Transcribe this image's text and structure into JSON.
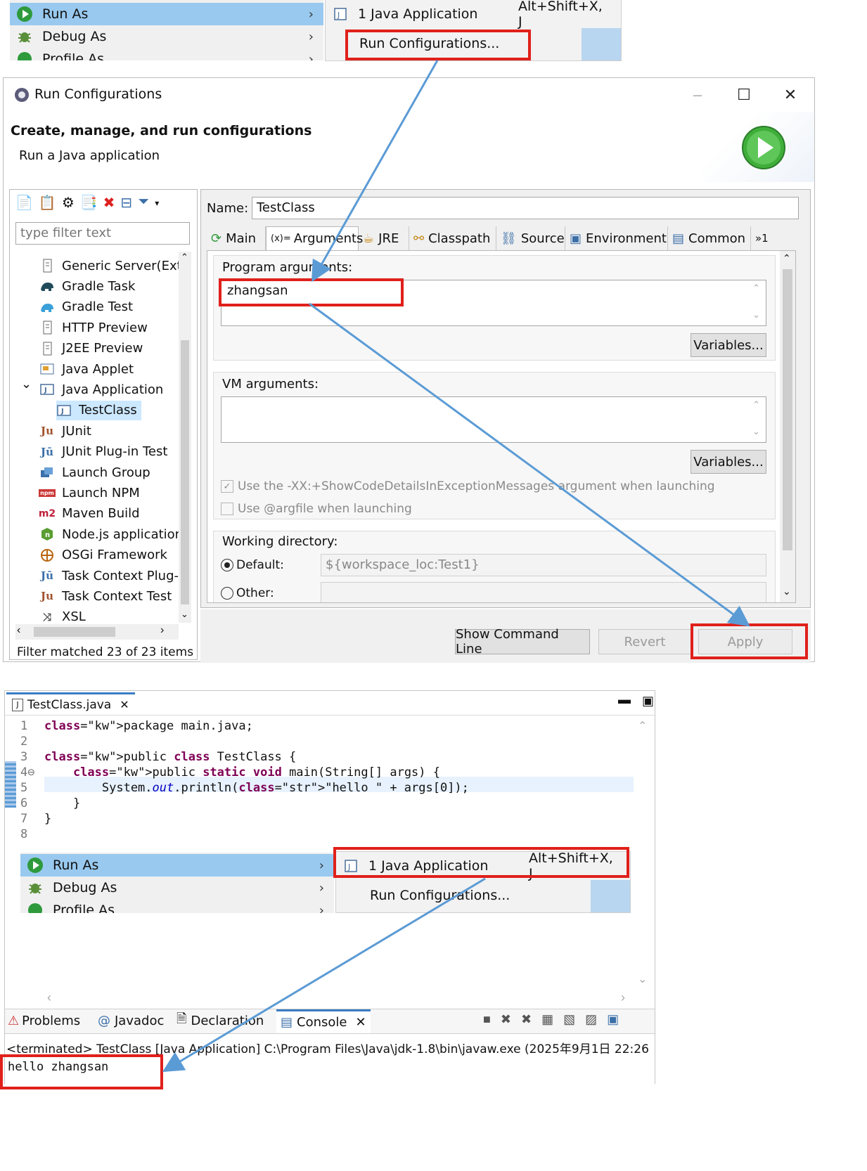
{
  "top_menu": {
    "items": [
      {
        "label": "Run As",
        "selected": true
      },
      {
        "label": "Debug As",
        "selected": false
      },
      {
        "label": "Profile As",
        "selected": false
      }
    ],
    "submenu": {
      "item1": {
        "label": "1 Java Application",
        "shortcut": "Alt+Shift+X, J"
      },
      "item2": {
        "label": "Run Configurations..."
      }
    }
  },
  "dialog": {
    "title": "Run Configurations",
    "header_title": "Create, manage, and run configurations",
    "header_subtitle": "Run a Java application",
    "window_controls": {
      "minimize": "–",
      "maximize": "☐",
      "close": "✕"
    },
    "filter_placeholder": "type filter text",
    "tree_items": [
      {
        "label": "Generic Server(Exte",
        "icon": "doc",
        "indent": 0
      },
      {
        "label": "Gradle Task",
        "icon": "elephant",
        "indent": 0
      },
      {
        "label": "Gradle Test",
        "icon": "elephant-blue",
        "indent": 0
      },
      {
        "label": "HTTP Preview",
        "icon": "doc",
        "indent": 0
      },
      {
        "label": "J2EE Preview",
        "icon": "doc",
        "indent": 0
      },
      {
        "label": "Java Applet",
        "icon": "applet",
        "indent": 0
      },
      {
        "label": "Java Application",
        "icon": "java-app",
        "indent": 0,
        "expanded": true
      },
      {
        "label": "TestClass",
        "icon": "java-app",
        "indent": 1,
        "selected": true
      },
      {
        "label": "JUnit",
        "icon": "junit",
        "indent": 0
      },
      {
        "label": "JUnit Plug-in Test",
        "icon": "junit-plugin",
        "indent": 0
      },
      {
        "label": "Launch Group",
        "icon": "launch-group",
        "indent": 0
      },
      {
        "label": "Launch NPM",
        "icon": "npm",
        "indent": 0
      },
      {
        "label": "Maven Build",
        "icon": "m2",
        "indent": 0
      },
      {
        "label": "Node.js application",
        "icon": "nodejs",
        "indent": 0
      },
      {
        "label": "OSGi Framework",
        "icon": "osgi",
        "indent": 0
      },
      {
        "label": "Task Context Plug-i",
        "icon": "junit-plugin",
        "indent": 0
      },
      {
        "label": "Task Context Test",
        "icon": "junit",
        "indent": 0
      },
      {
        "label": "XSL",
        "icon": "xsl",
        "indent": 0
      }
    ],
    "filter_status": "Filter matched 23 of 23 items",
    "name_label": "Name:",
    "name_value": "TestClass",
    "tabs": [
      {
        "label": "Main"
      },
      {
        "label": "Arguments",
        "active": true
      },
      {
        "label": "JRE"
      },
      {
        "label": "Classpath"
      },
      {
        "label": "Source"
      },
      {
        "label": "Environment"
      },
      {
        "label": "Common"
      },
      {
        "label": "»1"
      }
    ],
    "program_args_label": "Program arguments:",
    "program_args_value": "zhangsan",
    "vm_args_label": "VM arguments:",
    "vm_args_value": "",
    "variables_label": "Variables...",
    "show_code_details_label": "Use the -XX:+ShowCodeDetailsInExceptionMessages argument when launching",
    "argfile_label": "Use @argfile when launching",
    "working_dir_label": "Working directory:",
    "default_label": "Default:",
    "default_value": "${workspace_loc:Test1}",
    "other_label": "Other:",
    "show_command_line": "Show Command Line",
    "revert": "Revert",
    "apply": "Apply"
  },
  "editor": {
    "tab_title": "TestClass.java",
    "lines": [
      {
        "n": "1",
        "text": "package main.java;"
      },
      {
        "n": "2",
        "text": ""
      },
      {
        "n": "3",
        "text": "public class TestClass {"
      },
      {
        "n": "4⊖",
        "text": "    public static void main(String[] args) {"
      },
      {
        "n": "5",
        "text": "        System.out.println(\"hello \" + args[0]);"
      },
      {
        "n": "6",
        "text": "    }"
      },
      {
        "n": "7",
        "text": "}"
      },
      {
        "n": "8",
        "text": ""
      }
    ],
    "menu": {
      "items": [
        {
          "label": "Run As"
        },
        {
          "label": "Debug As"
        },
        {
          "label": "Profile As"
        }
      ],
      "submenu": {
        "item1": {
          "label": "1 Java Application",
          "shortcut": "Alt+Shift+X, J"
        },
        "item2": {
          "label": "Run Configurations..."
        }
      }
    }
  },
  "console": {
    "tabs": [
      "Problems",
      "Javadoc",
      "Declaration",
      "Console"
    ],
    "status": "<terminated> TestClass [Java Application] C:\\Program Files\\Java\\jdk-1.8\\bin\\javaw.exe  (2025年9月1日 22:26",
    "output": "hello zhangsan"
  },
  "colors": {
    "highlight_red": "#e0201b",
    "arrow_blue": "#5b9bd5",
    "menu_selected": "#99c9ef",
    "keyword": "#7f0055",
    "string": "#2a00ff"
  }
}
